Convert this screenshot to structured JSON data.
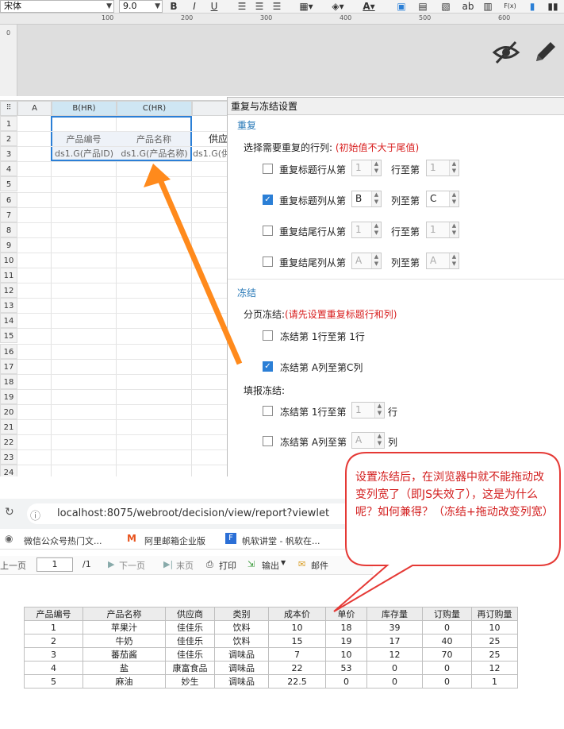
{
  "toolbar": {
    "font_name": "宋体",
    "font_size": "9.0",
    "bold": "B",
    "italic": "I",
    "underline": "U",
    "ab_label": "ab",
    "fx_label": "F(x)"
  },
  "ruler": {
    "ticks": [
      "100",
      "200",
      "300",
      "400",
      "500",
      "600"
    ],
    "vmark": "0"
  },
  "grid": {
    "columns": [
      "A",
      "B(HR)",
      "C(HR)"
    ],
    "extra_col": "供",
    "rows": [
      "1",
      "2",
      "3",
      "4",
      "5",
      "6",
      "7",
      "8",
      "9",
      "10",
      "11",
      "12",
      "13",
      "14",
      "15",
      "16",
      "17",
      "18",
      "19",
      "20",
      "21",
      "22",
      "23",
      "24"
    ],
    "cells": {
      "b2": "产品编号",
      "c2": "产品名称",
      "b3": "ds1.G(产品ID)",
      "c3": "ds1.G(产品名称)",
      "d3": "ds1.G(供",
      "d2": "供应"
    }
  },
  "dialog": {
    "title": "重复与冻结设置",
    "repeat_section": "重复",
    "repeat_prompt": "选择需要重复的行列:",
    "repeat_hint": "(初始值不大于尾值)",
    "rows": [
      {
        "label": "重复标题行从第",
        "v1": "1",
        "mid": "行至第",
        "v2": "1",
        "checked": false
      },
      {
        "label": "重复标题列从第",
        "v1": "B",
        "mid": "列至第",
        "v2": "C",
        "checked": true
      },
      {
        "label": "重复结尾行从第",
        "v1": "1",
        "mid": "行至第",
        "v2": "1",
        "checked": false
      },
      {
        "label": "重复结尾列从第",
        "v1": "A",
        "mid": "列至第",
        "v2": "A",
        "checked": false
      }
    ],
    "freeze_section": "冻结",
    "page_freeze_label": "分页冻结:",
    "page_freeze_hint": "(请先设置重复标题行和列)",
    "freeze_row": "冻结第 1行至第 1行",
    "freeze_col": "冻结第 A列至第C列",
    "fill_freeze_label": "填报冻结:",
    "fill_row_pre": "冻结第 1行至第",
    "fill_row_val": "1",
    "fill_row_post": "行",
    "fill_col_pre": "冻结第 A列至第",
    "fill_col_val": "A",
    "fill_col_post": "列"
  },
  "browser": {
    "url": "localhost:8075/webroot/decision/view/report?viewlet",
    "bookmarks": [
      "微信公众号热门文...",
      "阿里邮箱企业版",
      "帆软讲堂 - 帆软在..."
    ],
    "toolbar": {
      "prev": "上一页",
      "page": "1",
      "total": "/1",
      "next": "下一页",
      "last": "末页",
      "print": "打印",
      "export": "输出",
      "mail": "邮件"
    }
  },
  "report": {
    "headers": [
      "产品编号",
      "产品名称",
      "供应商",
      "类别",
      "成本价",
      "单价",
      "库存量",
      "订购量",
      "再订购量"
    ],
    "rows": [
      [
        "1",
        "苹果汁",
        "佳佳乐",
        "饮料",
        "10",
        "18",
        "39",
        "0",
        "10"
      ],
      [
        "2",
        "牛奶",
        "佳佳乐",
        "饮料",
        "15",
        "19",
        "17",
        "40",
        "25"
      ],
      [
        "3",
        "蕃茄酱",
        "佳佳乐",
        "调味品",
        "7",
        "10",
        "12",
        "70",
        "25"
      ],
      [
        "4",
        "盐",
        "康富食品",
        "调味品",
        "22",
        "53",
        "0",
        "0",
        "12"
      ],
      [
        "5",
        "麻油",
        "妙生",
        "调味品",
        "22.5",
        "0",
        "0",
        "0",
        "1"
      ]
    ]
  },
  "callout": {
    "text": "设置冻结后，在浏览器中就不能拖动改变列宽了（即JS失效了），这是为什么呢？如何兼得？（冻结+拖动改变列宽）"
  },
  "colors": {
    "accent": "#2b7fd6",
    "arrow": "#ff8a1c",
    "callout": "#e53935"
  }
}
